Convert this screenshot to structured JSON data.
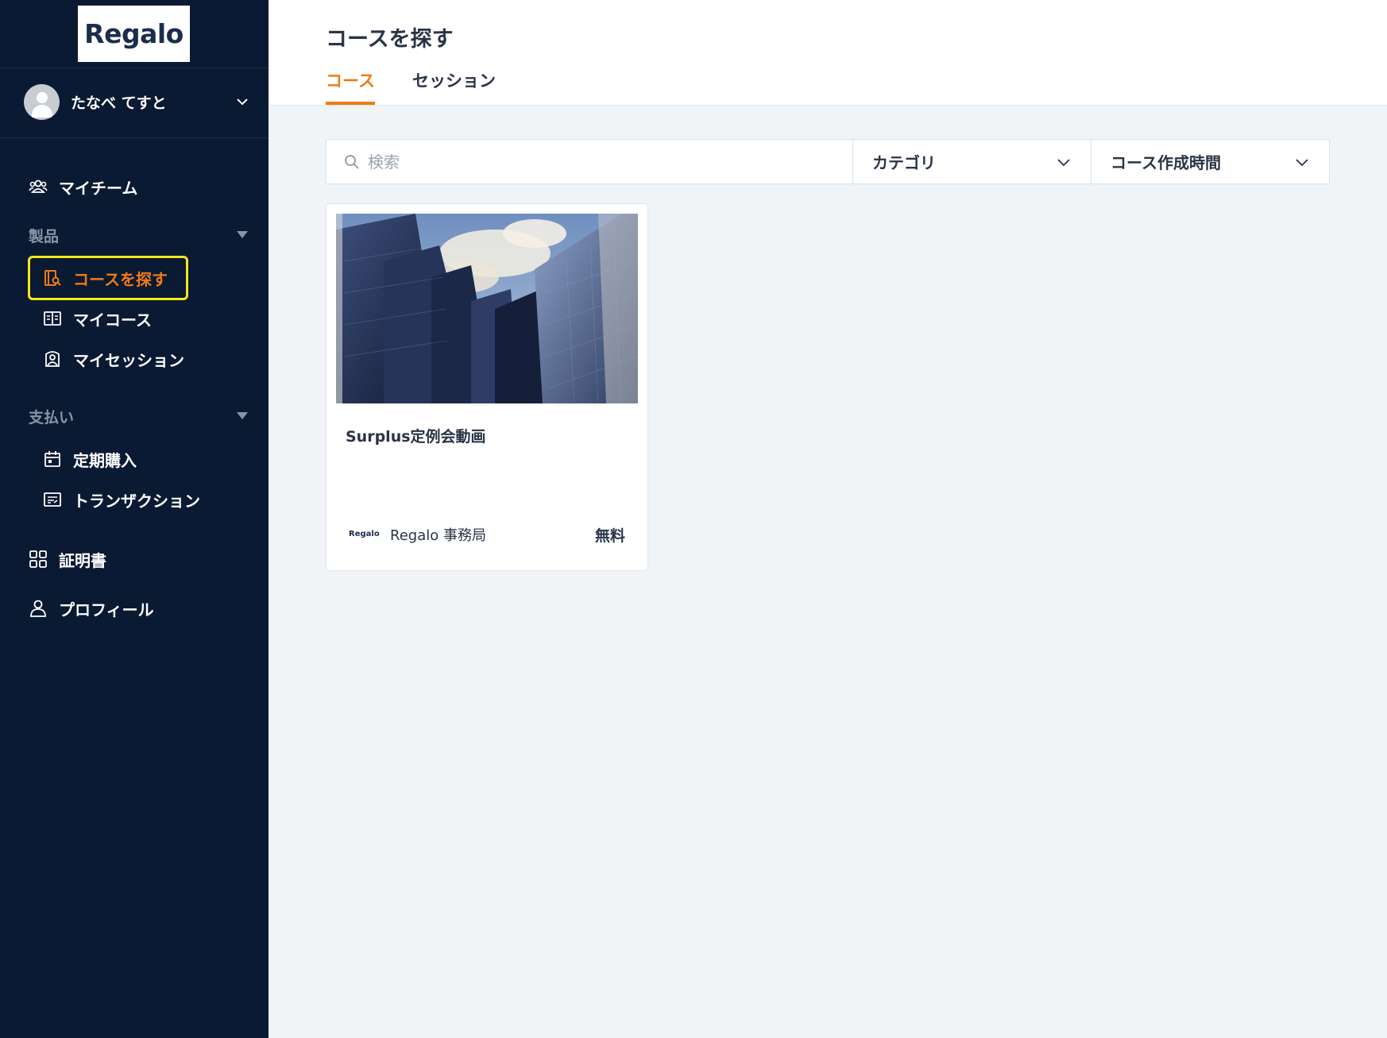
{
  "brand": {
    "logo_text": "Regalo",
    "accent_color": "#f07a14",
    "sidebar_bg": "#0b1a33"
  },
  "user": {
    "name": "たなべ てすと"
  },
  "sidebar": {
    "my_team": "マイチーム",
    "section_products": "製品",
    "find_courses": "コースを探す",
    "my_courses": "マイコース",
    "my_sessions": "マイセッション",
    "section_payments": "支払い",
    "subscriptions": "定期購入",
    "transactions": "トランザクション",
    "certificates": "証明書",
    "profile": "プロフィール"
  },
  "header": {
    "title": "コースを探す",
    "tabs": [
      {
        "label": "コース",
        "active": true
      },
      {
        "label": "セッション",
        "active": false
      }
    ]
  },
  "filters": {
    "search_placeholder": "検索",
    "category": "カテゴリ",
    "sort": "コース作成時間"
  },
  "courses": [
    {
      "title": "Surplus定例会動画",
      "provider_logo": "Regalo",
      "provider": "Regalo 事務局",
      "price": "無料"
    }
  ]
}
